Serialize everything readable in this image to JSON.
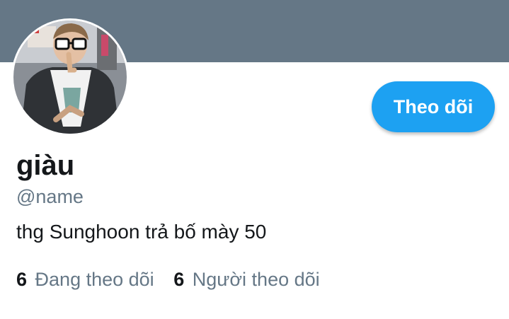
{
  "colors": {
    "banner": "#657786",
    "accent": "#1da1f2",
    "text_primary": "#14171a",
    "text_secondary": "#657786"
  },
  "profile": {
    "avatar_icon": "user-photo",
    "display_name": "giàu",
    "handle": "@name",
    "bio": "thg Sunghoon trả bố mày 50"
  },
  "actions": {
    "follow_label": "Theo dõi"
  },
  "stats": {
    "following_count": "6",
    "following_label": "Đang theo dõi",
    "followers_count": "6",
    "followers_label": "Người theo dõi"
  }
}
